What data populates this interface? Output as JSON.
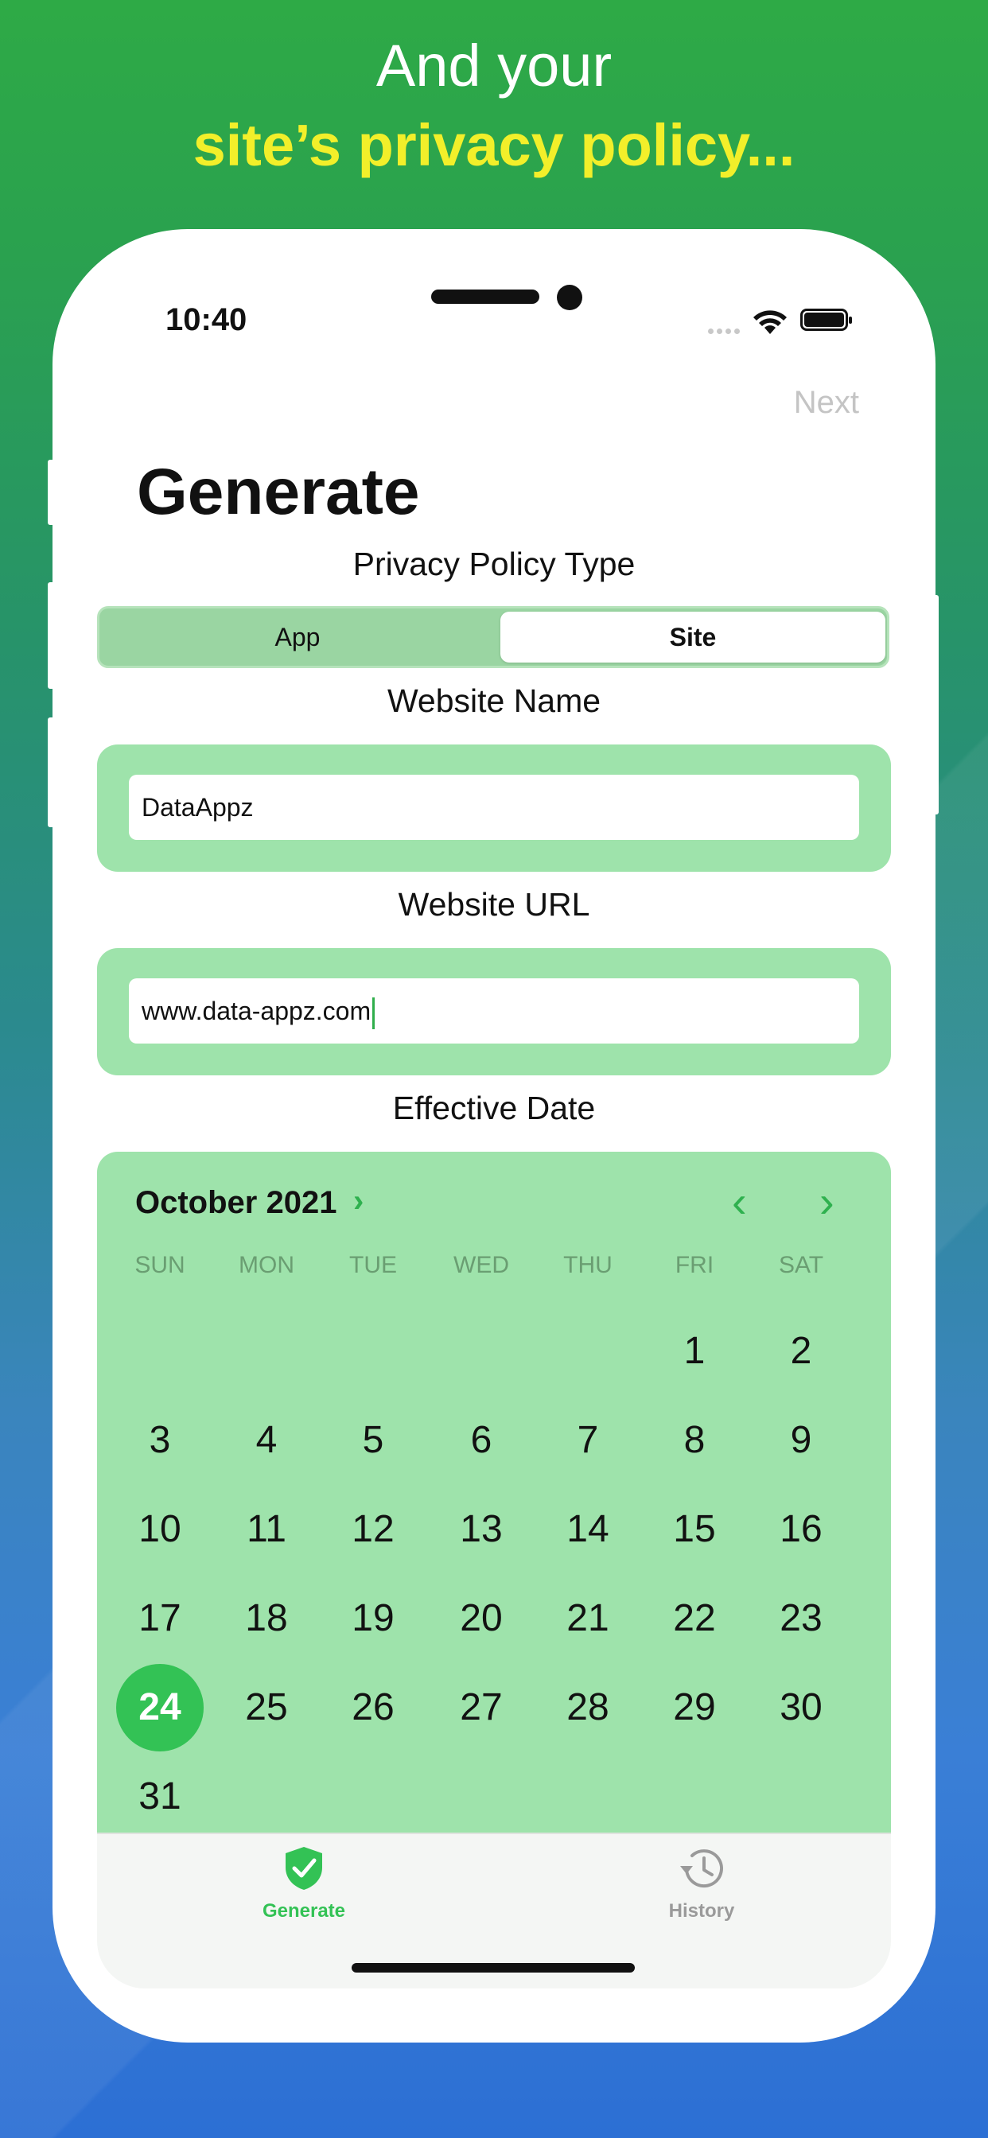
{
  "promo": {
    "line1": "And your",
    "line2": "site’s privacy policy..."
  },
  "colors": {
    "accent_green": "#33c255",
    "card_green": "#9ee3ab",
    "headline_yellow": "#f2ef2a"
  },
  "status_bar": {
    "time": "10:40"
  },
  "nav": {
    "next_label": "Next",
    "title": "Generate"
  },
  "policy_type": {
    "label": "Privacy Policy Type",
    "options": [
      "App",
      "Site"
    ],
    "selected": "Site"
  },
  "website_name": {
    "label": "Website Name",
    "value": "DataAppz"
  },
  "website_url": {
    "label": "Website URL",
    "value": "www.data-appz.com"
  },
  "effective_date": {
    "label": "Effective Date",
    "month_label": "October 2021",
    "weekdays": [
      "SUN",
      "MON",
      "TUE",
      "WED",
      "THU",
      "FRI",
      "SAT"
    ],
    "days": [
      "1",
      "2",
      "3",
      "4",
      "5",
      "6",
      "7",
      "8",
      "9",
      "10",
      "11",
      "12",
      "13",
      "14",
      "15",
      "16",
      "17",
      "18",
      "19",
      "20",
      "21",
      "22",
      "23",
      "24",
      "25",
      "26",
      "27",
      "28",
      "29",
      "30",
      "31"
    ],
    "first_weekday_index": 5,
    "selected_day": "24"
  },
  "tabs": {
    "generate_label": "Generate",
    "history_label": "History",
    "active": "Generate"
  }
}
